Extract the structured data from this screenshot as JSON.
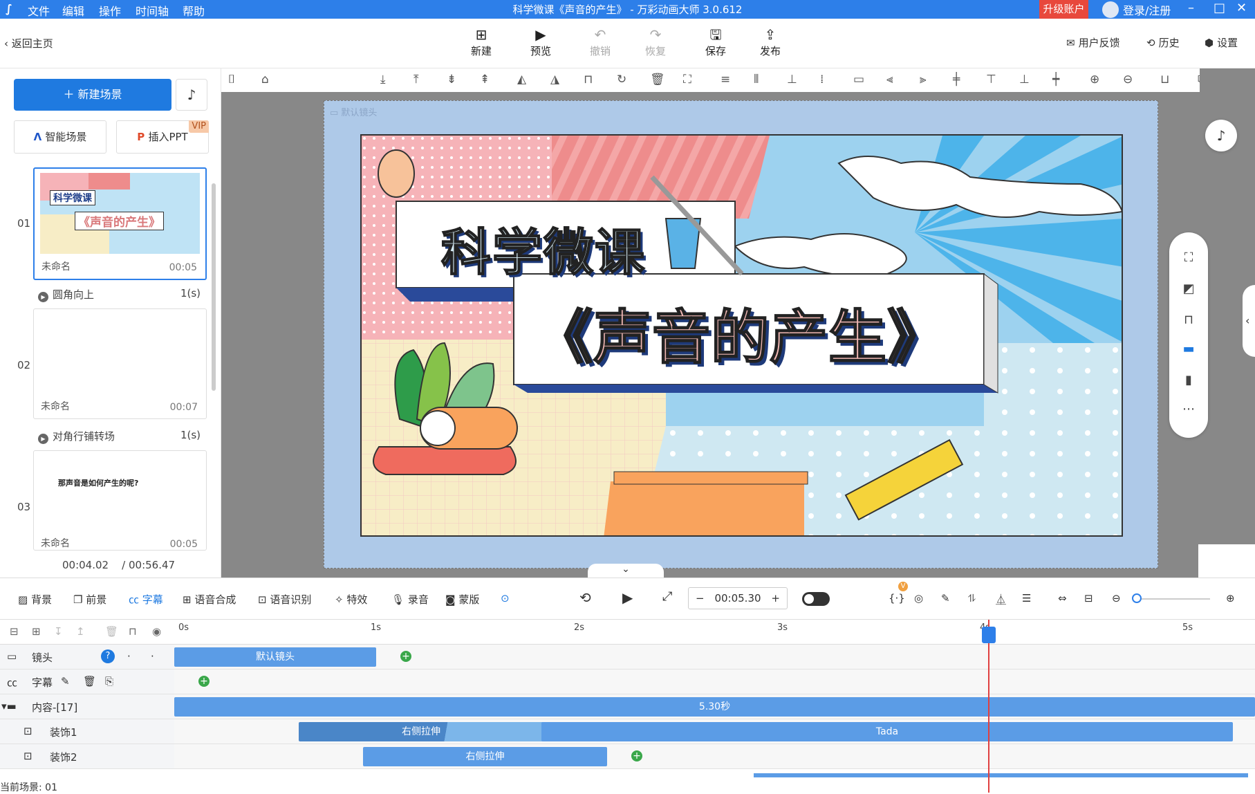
{
  "titlebar": {
    "menu": [
      "文件",
      "编辑",
      "操作",
      "时间轴",
      "帮助"
    ],
    "title": "科学微课《声音的产生》 - 万彩动画大师 3.0.612",
    "upgrade": "升级账户",
    "login": "登录/注册"
  },
  "toolbar": {
    "back": "返回主页",
    "buttons": [
      {
        "label": "新建",
        "icon": "plus-box-icon"
      },
      {
        "label": "预览",
        "icon": "play-icon"
      },
      {
        "label": "撤销",
        "icon": "undo-icon"
      },
      {
        "label": "恢复",
        "icon": "redo-icon"
      },
      {
        "label": "保存",
        "icon": "save-icon"
      },
      {
        "label": "发布",
        "icon": "publish-icon"
      }
    ],
    "feedback": "用户反馈",
    "history": "历史",
    "settings": "设置"
  },
  "left": {
    "new_scene": "新建场景",
    "smart_scene": "智能场景",
    "insert_ppt": "插入PPT",
    "vip": "VIP",
    "scenes": [
      {
        "num": "01",
        "name": "未命名",
        "time": "00:05",
        "thumb_title": "科学微课",
        "thumb_sub": "《声音的产生》"
      },
      {
        "num": "02",
        "name": "未命名",
        "time": "00:07"
      },
      {
        "num": "03",
        "name": "未命名",
        "time": "00:05",
        "text": "那声音是如何产生的呢?"
      }
    ],
    "transitions": [
      {
        "name": "圆角向上",
        "dur": "1(s)"
      },
      {
        "name": "对角行铺转场",
        "dur": "1(s)"
      }
    ],
    "current_time": "00:04.02",
    "total_time": "/ 00:56.47"
  },
  "canvas": {
    "camera_label": "默认镜头",
    "title": "科学微课",
    "subtitle": "《声音的产生》"
  },
  "tltools": {
    "items": [
      "背景",
      "前景",
      "字幕",
      "语音合成",
      "语音识别",
      "特效",
      "录音",
      "蒙版"
    ],
    "time": "00:05.30",
    "badge": "V"
  },
  "timeline": {
    "ticks": [
      "0s",
      "1s",
      "2s",
      "3s",
      "4s",
      "5s"
    ],
    "tracks": [
      {
        "label": "镜头",
        "clip": "默认镜头"
      },
      {
        "label": "字幕"
      },
      {
        "label": "内容-[17]",
        "clip": "5.30秒"
      },
      {
        "label": "装饰1",
        "clip1": "右侧拉伸",
        "clip2": "Tada"
      },
      {
        "label": "装饰2",
        "clip1": "右侧拉伸"
      }
    ],
    "status": "当前场景: 01"
  }
}
